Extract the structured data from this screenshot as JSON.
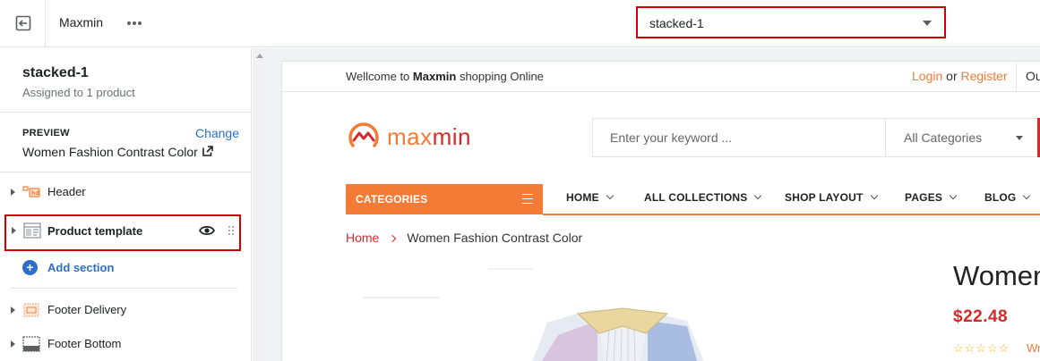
{
  "topbar": {
    "store_name": "Maxmin",
    "template_selected": "stacked-1"
  },
  "sidebar": {
    "title": "stacked-1",
    "subtitle": "Assigned to 1 product",
    "preview_label": "PREVIEW",
    "preview_change": "Change",
    "preview_product": "Women Fashion Contrast Color",
    "sections": [
      {
        "label": "Header",
        "icon": "header-section-icon"
      },
      {
        "label": "Product template",
        "icon": "template-section-icon",
        "highlighted": true
      },
      {
        "label": "Footer Delivery",
        "icon": "footer-delivery-icon"
      },
      {
        "label": "Footer Bottom",
        "icon": "footer-bottom-icon"
      }
    ],
    "add_section": "Add section"
  },
  "preview": {
    "welcome_prefix": "Wellcome to",
    "welcome_brand": "Maxmin",
    "welcome_suffix": "shopping Online",
    "login": "Login",
    "or": "or",
    "register": "Register",
    "topline_more": "Ou",
    "logo_part1": "max",
    "logo_part2": "min",
    "search_placeholder": "Enter your keyword ...",
    "search_category": "All Categories",
    "categories_label": "CATEGORIES",
    "nav": [
      "HOME",
      "ALL COLLECTIONS",
      "SHOP LAYOUT",
      "PAGES",
      "BLOG"
    ],
    "breadcrumb_home": "Home",
    "breadcrumb_current": "Women Fashion Contrast Color",
    "product_title": "Women",
    "product_price": "$22.48",
    "rating_stars": "☆☆☆☆☆",
    "write_review": "Wr"
  },
  "colors": {
    "accent_orange": "#f47b36",
    "accent_red": "#d42a2a",
    "highlight_border": "#d40000",
    "link_blue": "#2c6ecb"
  }
}
